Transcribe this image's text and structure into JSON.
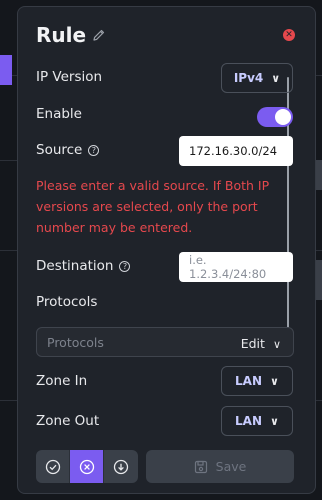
{
  "modal": {
    "title": "Rule",
    "ip_version": {
      "label": "IP Version",
      "value": "IPv4"
    },
    "enable": {
      "label": "Enable",
      "on": true
    },
    "source": {
      "label": "Source",
      "value": "172.16.30.0/24"
    },
    "error": "Please enter a valid source. If Both IP versions are selected, only the port number may be entered.",
    "destination": {
      "label": "Destination",
      "placeholder": "i.e. 1.2.3.4/24:80"
    },
    "protocols": {
      "label": "Protocols",
      "placeholder": "Protocols",
      "edit": "Edit"
    },
    "zone_in": {
      "label": "Zone In",
      "value": "LAN"
    },
    "zone_out": {
      "label": "Zone Out",
      "value": "LAN"
    },
    "save_label": "Save"
  },
  "colors": {
    "accent": "#7b5cf0",
    "error": "#e5484d",
    "panel": "#1f232a"
  },
  "icons": {
    "edit": "pencil-icon",
    "close": "close-icon",
    "help": "help-icon",
    "chevron": "chevron-down-icon",
    "check": "check-icon",
    "cancel": "x-icon",
    "download": "download-icon",
    "save": "floppy-icon"
  }
}
